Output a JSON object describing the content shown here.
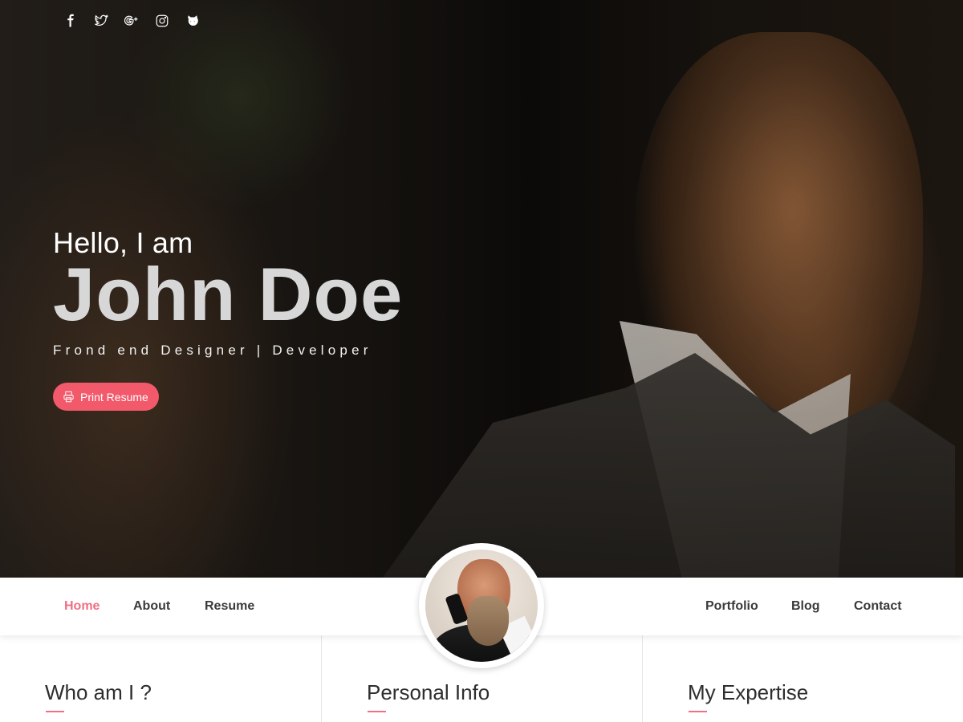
{
  "socials": {
    "icons": [
      "facebook-icon",
      "twitter-icon",
      "google-plus-icon",
      "instagram-icon",
      "github-icon"
    ]
  },
  "hero": {
    "greeting": "Hello, I am",
    "name": "John Doe",
    "role": "Frond end Designer | Developer",
    "print_button": "Print Resume"
  },
  "nav": {
    "items": [
      "Home",
      "About",
      "Resume",
      "Portfolio",
      "Blog",
      "Contact"
    ],
    "active": "Home"
  },
  "sections": [
    {
      "title": "Who am I ?"
    },
    {
      "title": "Personal Info"
    },
    {
      "title": "My Expertise"
    }
  ],
  "colors": {
    "accent": "#f07084",
    "button": "#f2596a",
    "text": "#3a3a3a"
  }
}
